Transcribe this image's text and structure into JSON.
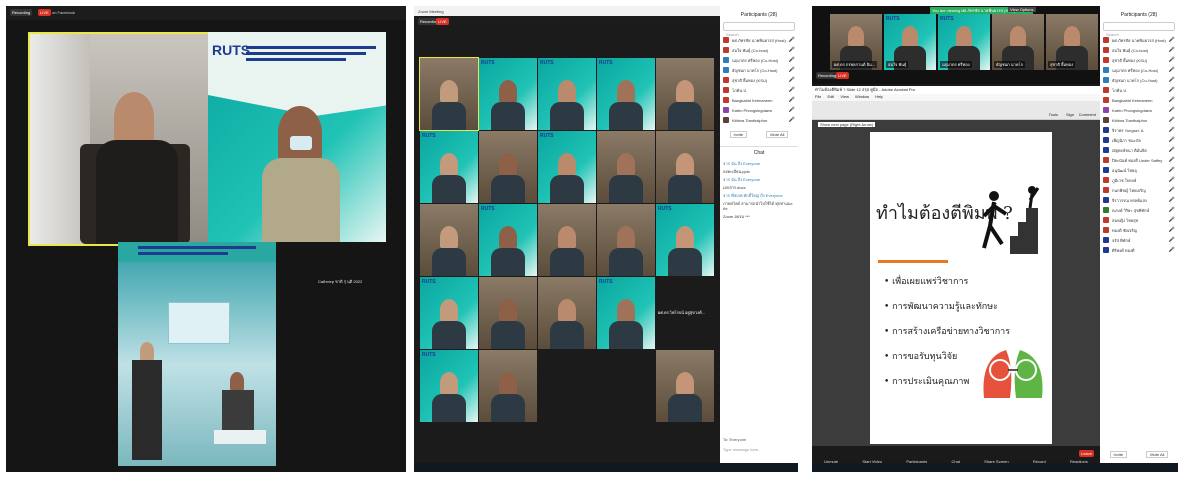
{
  "panel1": {
    "recording_label": "Recording",
    "live_label": "LIVE",
    "stream_label": "on Facebook",
    "tile_logo": "RUTS",
    "side_label": "Сайтлер ชาติ รุ่ นฺติ 2022"
  },
  "panel2": {
    "title": "Zoom Meeting",
    "participants_header": "Participants (28)",
    "participants": [
      {
        "name": "ผศ.ภัทรชัย นาคพินยวรส (Host)",
        "color": "#c0392b"
      },
      {
        "name": "สมใจ พันธุ์ (Co-host)",
        "color": "#c0392b"
      },
      {
        "name": "นฤมาตร ศรีทอง (Co-Host)",
        "color": "#2c7fb8"
      },
      {
        "name": "ธัญชนก นาคโก (Co-Host)",
        "color": "#2c7fb8"
      },
      {
        "name": "สุชาติ ยิ้มทอง (KSU)",
        "color": "#c0392b"
      },
      {
        "name": "โภคิน ป.",
        "color": "#c0392b"
      },
      {
        "name": "Bangkabid Ketmaneen",
        "color": "#c0392b"
      },
      {
        "name": "Katrin Phongsingdaew",
        "color": "#8e44ad"
      },
      {
        "name": "Kittima Tianthalphor",
        "color": "#5d4037"
      }
    ],
    "invite_label": "Invite",
    "mute_all_label": "Mute All",
    "chat_header": "Chat",
    "chat_messages": [
      "จาก ฉัน ถึง Everyone",
      "ลงทะเบียน.pptx",
      "จาก ฉัน ถึง Everyone",
      "เอกสาร.docx",
      "จาก พี่ชเรศ ศักดิ์ใหญ่ ถึง Everyone",
      "ภาพสไลด์ สามารถนำไปใช้ได้ ทุกท่านนะคะ",
      "Zoom อบรม ***"
    ],
    "chat_placeholder": "Type message here...",
    "to_label": "To: Everyone",
    "tile_caption": "ผศ.ดร.ไพโรจน์ อยู่สุขวงศ์...",
    "tile_logo": "RUTS"
  },
  "panel3": {
    "top_banner": "You are viewing ผศ.ภัทรชัย นาคพินยวรส (Host)'s screen",
    "view_options": "View Options",
    "thumb_names": [
      "ผศ.ดร.กรพลกานต์ อิน...",
      "สมใจ พันธุ์",
      "นฤมาตร ศรีทอง",
      "ธัญชนก นาคโก",
      "สุชาติ ยิ้มทอง"
    ],
    "thumb_logo": "RUTS",
    "acrobat_title": "ทำไมต้องตีพิมพ์ ? Slide 12 สรุป คู่มือ - Adobe Acrobat Pro",
    "menu": [
      "File",
      "Edit",
      "View",
      "Window",
      "Help"
    ],
    "toolbar_right": [
      "Tools",
      "Sign",
      "Comment"
    ],
    "page_label": "Show next page (Right Arrow)",
    "slide_title": "ทำไมต้องตีพิมพ์ ?",
    "bullets": [
      "เพื่อเผยแพร่วิชาการ",
      "การพัฒนาความรู้และทักษะ",
      "การสร้างเครือข่ายทางวิชาการ",
      "การขอรับทุนวิจัย",
      "การประเมินคุณภาพ"
    ],
    "participants_header": "Participants (28)",
    "participants": [
      {
        "name": "ผศ.ภัทรชัย นาคพินยวรส (Host)",
        "color": "#c0392b"
      },
      {
        "name": "สมใจ พันธุ์ (Co-host)",
        "color": "#c0392b"
      },
      {
        "name": "สุชาติ ยิ้มทอง (KSU)",
        "color": "#c0392b"
      },
      {
        "name": "นฤมาตร ศรีทอง (Co-Host)",
        "color": "#2c7fb8"
      },
      {
        "name": "ธัญชนก นาคโก (Co-Host)",
        "color": "#2c7fb8"
      },
      {
        "name": "โภคิน ป.",
        "color": "#c0392b"
      },
      {
        "name": "Bangkabid Ketmaneen",
        "color": "#c0392b"
      },
      {
        "name": "Katrin Phongsingdaew",
        "color": "#8e44ad"
      },
      {
        "name": "Kittima Tianthalphor",
        "color": "#5d4037"
      },
      {
        "name": "จิราพร Yongsiri. A.",
        "color": "#1f3a93"
      },
      {
        "name": "เพ็ญนิภา ชนะภัย",
        "color": "#1f3a93"
      },
      {
        "name": "ณัฐพงษ์ชนา ดีมั่นจิต",
        "color": "#1f3a93"
      },
      {
        "name": "ปิยะนันท์ ทองดี Under Saffey",
        "color": "#c0392b"
      },
      {
        "name": "อนุนัฒน์ ไชยอุ",
        "color": "#1f3a93"
      },
      {
        "name": "ภูมิเวช ใจหงษ์",
        "color": "#c0392b"
      },
      {
        "name": "กนกพิชญ์ ไทยเจริญ",
        "color": "#c0392b"
      },
      {
        "name": "จิราวรรณ ทรพย์แสง",
        "color": "#1f3a93"
      },
      {
        "name": "ณรงค์ วิริยะ สุขพิทักษ์",
        "color": "#2e7d32"
      },
      {
        "name": "สมหญิง ไทยสุข",
        "color": "#c0392b"
      },
      {
        "name": "ทองดี ชัยเจริญ",
        "color": "#c0392b"
      },
      {
        "name": "จรัส พิทักษ์",
        "color": "#1f3a93"
      },
      {
        "name": "ศิริพงศ์ ทองดี",
        "color": "#1f3a93"
      }
    ],
    "invite_label": "Invite",
    "mute_all_label": "Mute All",
    "bottom_controls": [
      "Unmute",
      "Start Video",
      "Participants",
      "Chat",
      "Share Screen",
      "Record",
      "Reactions"
    ],
    "end_label": "Leave"
  }
}
